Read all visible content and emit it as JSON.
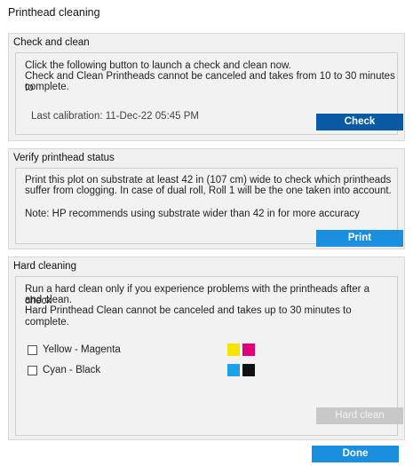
{
  "window": {
    "title": "Printhead cleaning"
  },
  "check_clean": {
    "header": "Check and clean",
    "line1": "Click the following button to launch a check and clean now.",
    "line2": "Check and Clean Printheads cannot be canceled and takes from 10 to 30 minutes to",
    "line3": "complete.",
    "last_calibration": "Last calibration: 11-Dec-22 05:45 PM",
    "button": "Check"
  },
  "verify": {
    "header": "Verify printhead status",
    "line1": "Print this plot on substrate at least 42 in (107 cm) wide to check which printheads",
    "line2": "suffer from clogging. In case of dual roll, Roll 1 will be the one taken into account.",
    "note": "Note: HP recommends using substrate wider than 42 in for more accuracy",
    "button": "Print"
  },
  "hard": {
    "header": "Hard cleaning",
    "line1": "Run a hard clean only if you experience problems with the printheads after a check",
    "line2": "and clean.",
    "line3": "Hard Printhead Clean cannot be canceled and takes up to 30 minutes to complete.",
    "options": [
      {
        "label": "Yellow - Magenta",
        "checked": false,
        "colors": [
          "#f5e400",
          "#e0007a"
        ]
      },
      {
        "label": "Cyan - Black",
        "checked": false,
        "colors": [
          "#1aa3e8",
          "#111111"
        ]
      }
    ],
    "button": "Hard clean",
    "button_enabled": false
  },
  "footer": {
    "done": "Done"
  }
}
